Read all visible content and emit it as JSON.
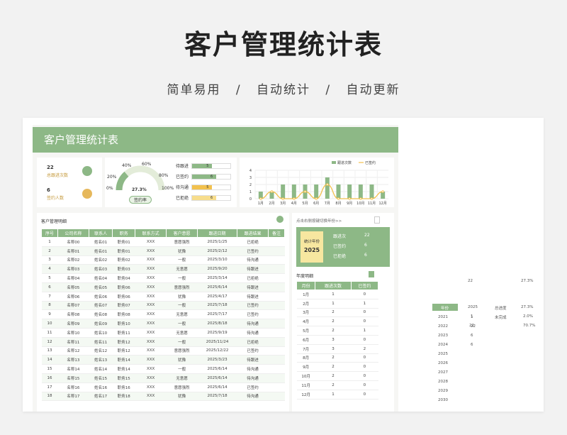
{
  "hero": {
    "title": "客户管理统计表",
    "subtitle": "简单易用 / 自动统计 / 自动更新"
  },
  "banner": {
    "title": "客户管理统计表"
  },
  "kpis": [
    {
      "value": "22",
      "label": "总跟进次数"
    },
    {
      "value": "6",
      "label": "签约人数"
    }
  ],
  "gauge": {
    "value": "27.3%",
    "label": "签约率",
    "ticks": [
      "0%",
      "20%",
      "40%",
      "60%",
      "80%",
      "100%"
    ],
    "fraction": 0.273
  },
  "status_bars": [
    {
      "label": "待跟进",
      "value": "5",
      "fraction": 0.83,
      "color": "#8db886"
    },
    {
      "label": "已签约",
      "value": "6",
      "fraction": 1.0,
      "color": "#8db886"
    },
    {
      "label": "待沟通",
      "value": "5",
      "fraction": 0.83,
      "color": "#f2c14e"
    },
    {
      "label": "已拒绝",
      "value": "6",
      "fraction": 1.0,
      "color": "#f7dd8c"
    }
  ],
  "chart_data": {
    "type": "bar",
    "categories": [
      "1月",
      "2月",
      "3月",
      "4月",
      "5月",
      "6月",
      "7月",
      "8月",
      "9月",
      "10月",
      "11月",
      "12月"
    ],
    "series": [
      {
        "name": "跟进次数",
        "type": "bar",
        "color": "#8db886",
        "values": [
          1,
          1,
          2,
          2,
          2,
          2,
          3,
          2,
          2,
          2,
          2,
          1
        ]
      },
      {
        "name": "已签约",
        "type": "line",
        "color": "#f2c14e",
        "values": [
          0,
          1,
          0,
          0,
          1,
          0,
          2,
          0,
          0,
          0,
          0,
          1
        ]
      }
    ],
    "ylim": [
      0,
      4
    ],
    "yticks": [
      "0",
      "1",
      "2",
      "3",
      "4"
    ],
    "legend": "top-right"
  },
  "detail": {
    "title": "客户管理明细",
    "headers": [
      "序号",
      "公司名称",
      "联系人",
      "职务",
      "联系方式",
      "客户意愿",
      "跟进日期",
      "跟进结果",
      "备注"
    ],
    "rows": [
      [
        "1",
        "名称00",
        "姓名01",
        "职务01",
        "XXX",
        "意愿强烈",
        "2025/1/25",
        "已拒绝",
        ""
      ],
      [
        "2",
        "名称01",
        "姓名01",
        "职务01",
        "XXX",
        "犹豫",
        "2025/2/12",
        "已签约",
        ""
      ],
      [
        "3",
        "名称02",
        "姓名02",
        "职务02",
        "XXX",
        "一般",
        "2025/3/10",
        "待沟通",
        ""
      ],
      [
        "4",
        "名称03",
        "姓名03",
        "职务03",
        "XXX",
        "无意愿",
        "2025/9/20",
        "待跟进",
        ""
      ],
      [
        "5",
        "名称04",
        "姓名04",
        "职务04",
        "XXX",
        "一般",
        "2025/3/14",
        "已拒绝",
        ""
      ],
      [
        "6",
        "名称05",
        "姓名05",
        "职务06",
        "XXX",
        "意愿强烈",
        "2025/6/14",
        "待跟进",
        ""
      ],
      [
        "7",
        "名称06",
        "姓名06",
        "职务06",
        "XXX",
        "犹豫",
        "2025/4/17",
        "待跟进",
        ""
      ],
      [
        "8",
        "名称07",
        "姓名07",
        "职务07",
        "XXX",
        "一般",
        "2025/7/18",
        "已签约",
        ""
      ],
      [
        "9",
        "名称08",
        "姓名08",
        "职务08",
        "XXX",
        "无意愿",
        "2025/7/17",
        "已签约",
        ""
      ],
      [
        "10",
        "名称09",
        "姓名09",
        "职务10",
        "XXX",
        "一般",
        "2025/8/18",
        "待沟通",
        ""
      ],
      [
        "11",
        "名称10",
        "姓名10",
        "职务11",
        "XXX",
        "无意愿",
        "2025/9/19",
        "待沟通",
        ""
      ],
      [
        "12",
        "名称11",
        "姓名11",
        "职务12",
        "XXX",
        "一般",
        "2025/11/24",
        "已拒绝",
        ""
      ],
      [
        "13",
        "名称12",
        "姓名12",
        "职务12",
        "XXX",
        "意愿强烈",
        "2025/12/22",
        "已签约",
        ""
      ],
      [
        "14",
        "名称13",
        "姓名13",
        "职务14",
        "XXX",
        "犹豫",
        "2025/3/23",
        "待跟进",
        ""
      ],
      [
        "15",
        "名称14",
        "姓名14",
        "职务14",
        "XXX",
        "一般",
        "2025/6/14",
        "待沟通",
        ""
      ],
      [
        "16",
        "名称15",
        "姓名15",
        "职务15",
        "XXX",
        "无意愿",
        "2025/6/14",
        "待沟通",
        ""
      ],
      [
        "17",
        "名称16",
        "姓名16",
        "职务16",
        "XXX",
        "意愿强烈",
        "2025/6/14",
        "已签约",
        ""
      ],
      [
        "18",
        "名称17",
        "姓名17",
        "职务18",
        "XXX",
        "犹豫",
        "2025/7/18",
        "待沟通",
        ""
      ]
    ]
  },
  "year_panel": {
    "hint": "点击右侧按键切换年份>>",
    "badge_label": "统计年份",
    "badge_year": "2025",
    "stats": [
      {
        "label": "跟进次",
        "value": "22"
      },
      {
        "label": "已签约",
        "value": "6"
      },
      {
        "label": "已拒绝",
        "value": "6"
      }
    ],
    "table_title": "年度明细",
    "headers": [
      "月份",
      "跟进次数",
      "已签约"
    ],
    "rows": [
      [
        "1月",
        "1",
        "0"
      ],
      [
        "2月",
        "1",
        "1"
      ],
      [
        "3月",
        "2",
        "0"
      ],
      [
        "4月",
        "2",
        "0"
      ],
      [
        "5月",
        "2",
        "1"
      ],
      [
        "6月",
        "3",
        "0"
      ],
      [
        "7月",
        "3",
        "2"
      ],
      [
        "8月",
        "2",
        "0"
      ],
      [
        "9月",
        "2",
        "0"
      ],
      [
        "10月",
        "2",
        "0"
      ],
      [
        "11月",
        "2",
        "0"
      ],
      [
        "12月",
        "1",
        "0"
      ]
    ]
  },
  "side": {
    "top_a": "22",
    "top_b": "27.3%",
    "year_label": "年份",
    "year_row": [
      "2025",
      "总进度",
      "27.3%"
    ],
    "row2": [
      "1",
      "未完成",
      "2.0%"
    ],
    "row3": [
      "22",
      "70.7%"
    ],
    "years": [
      "2021",
      "2022",
      "2023",
      "2024",
      "2025",
      "2026",
      "2027",
      "2028",
      "2029",
      "2030"
    ],
    "year_values": [
      "1",
      "22",
      "6",
      "6"
    ]
  }
}
